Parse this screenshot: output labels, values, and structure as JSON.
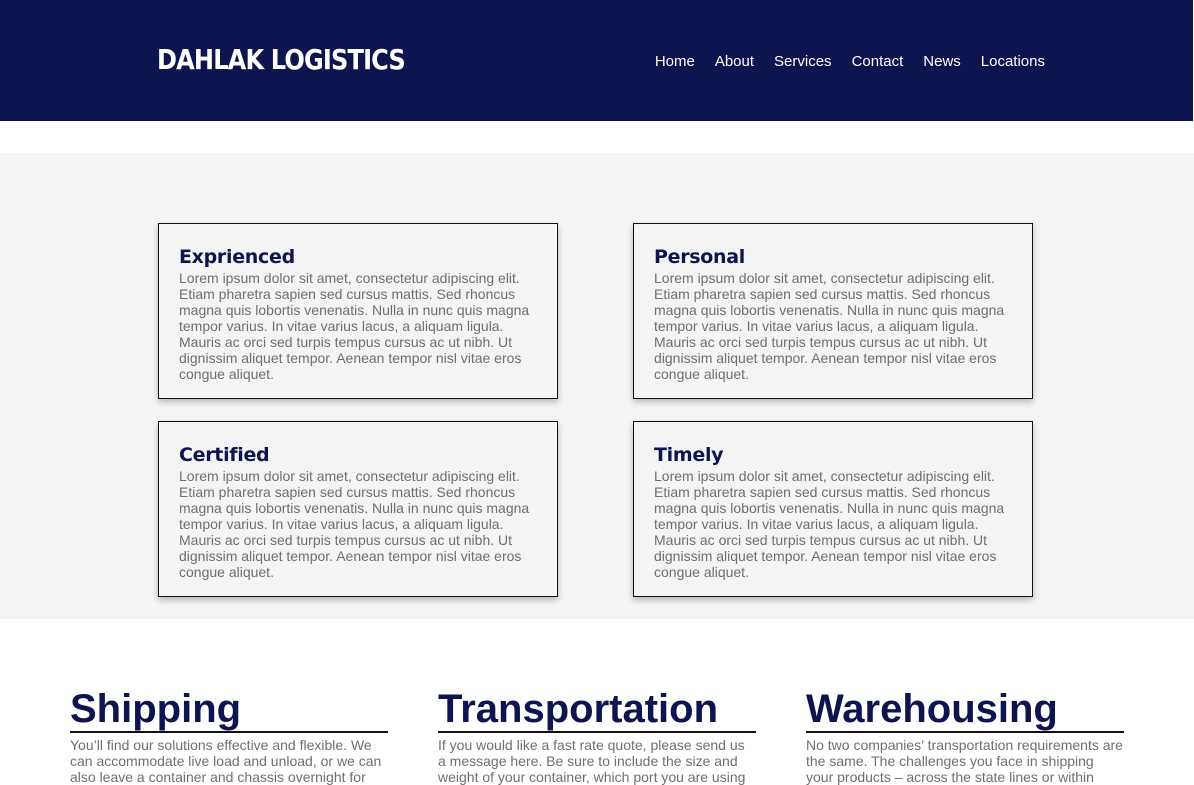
{
  "header": {
    "brand": "DAHLAK LOGISTICS",
    "nav": [
      "Home",
      "About",
      "Services",
      "Contact",
      "News",
      "Locations"
    ]
  },
  "features": [
    {
      "title": "Exprienced",
      "body": "Lorem ipsum dolor sit amet, consectetur adipiscing elit. Etiam pharetra sapien sed cursus mattis. Sed rhoncus magna quis lobortis venenatis. Nulla in nunc quis magna tempor varius. In vitae varius lacus, a aliquam ligula. Mauris ac orci sed turpis tempus cursus ac ut nibh. Ut dignissim aliquet tempor. Aenean tempor nisl vitae eros congue aliquet."
    },
    {
      "title": "Personal",
      "body": "Lorem ipsum dolor sit amet, consectetur adipiscing elit. Etiam pharetra sapien sed cursus mattis. Sed rhoncus magna quis lobortis venenatis. Nulla in nunc quis magna tempor varius. In vitae varius lacus, a aliquam ligula. Mauris ac orci sed turpis tempus cursus ac ut nibh. Ut dignissim aliquet tempor. Aenean tempor nisl vitae eros congue aliquet."
    },
    {
      "title": "Certified",
      "body": "Lorem ipsum dolor sit amet, consectetur adipiscing elit. Etiam pharetra sapien sed cursus mattis. Sed rhoncus magna quis lobortis venenatis. Nulla in nunc quis magna tempor varius. In vitae varius lacus, a aliquam ligula. Mauris ac orci sed turpis tempus cursus ac ut nibh. Ut dignissim aliquet tempor. Aenean tempor nisl vitae eros congue aliquet."
    },
    {
      "title": "Timely",
      "body": "Lorem ipsum dolor sit amet, consectetur adipiscing elit. Etiam pharetra sapien sed cursus mattis. Sed rhoncus magna quis lobortis venenatis. Nulla in nunc quis magna tempor varius. In vitae varius lacus, a aliquam ligula. Mauris ac orci sed turpis tempus cursus ac ut nibh. Ut dignissim aliquet tempor. Aenean tempor nisl vitae eros congue aliquet."
    }
  ],
  "services": [
    {
      "title": "Shipping",
      "body": "You’ll find our solutions effective and flexible. We can accommodate live load and unload, or we can also leave a container and chassis overnight for"
    },
    {
      "title": "Transportation",
      "body": "If you would like a fast rate quote, please send us a message here. Be sure to include the size and weight of your container, which port you are using"
    },
    {
      "title": "Warehousing",
      "body": "No two companies’ transportation requirements are the same. The challenges you face in shipping your products – across the state lines or within"
    }
  ],
  "colors": {
    "header_bg": "#0d1450",
    "accent": "#0d1450",
    "band_bg": "#f4f4f4",
    "body_text": "#6f6f6f"
  }
}
